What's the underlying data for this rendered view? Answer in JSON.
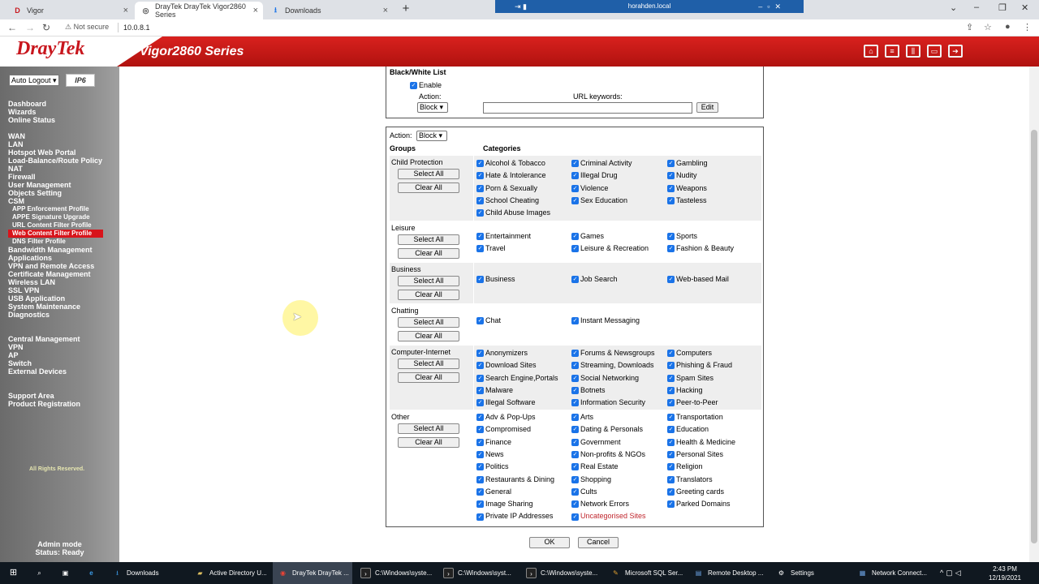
{
  "browser": {
    "tabs": [
      {
        "title": "Vigor",
        "fav": "D"
      },
      {
        "title": "DrayTek DrayTek Vigor2860 Series",
        "fav": "◎"
      },
      {
        "title": "Downloads",
        "fav": "⭳"
      }
    ],
    "remote_title": "horahden.local",
    "security_label": "Not secure",
    "url": "10.0.8.1"
  },
  "header": {
    "brand": "DrayTek",
    "model": "Vigor2860 Series"
  },
  "sidebar": {
    "auto_logout": "Auto Logout",
    "ipv6": "IP6",
    "groups": [
      [
        "Dashboard",
        "Wizards",
        "Online Status"
      ],
      [
        "WAN",
        "LAN",
        "Hotspot Web Portal",
        "Load-Balance/Route Policy",
        "NAT",
        "Firewall",
        "User Management",
        "Objects Setting",
        "CSM"
      ],
      [
        "Bandwidth Management",
        "Applications",
        "VPN and Remote Access",
        "Certificate Management",
        "Wireless LAN",
        "SSL VPN",
        "USB Application",
        "System Maintenance",
        "Diagnostics"
      ],
      [
        "Central Management",
        "VPN",
        "AP",
        "Switch",
        "External Devices"
      ],
      [
        "Support Area",
        "Product Registration"
      ]
    ],
    "csm_sub": [
      "APP Enforcement Profile",
      "APPE Signature Upgrade",
      "URL Content Filter Profile",
      "Web Content Filter Profile",
      "DNS Filter Profile"
    ],
    "rights": "All Rights Reserved.",
    "admin_mode": "Admin mode",
    "status": "Status: Ready"
  },
  "bwl": {
    "title": "Black/White List",
    "enable": "Enable",
    "action_label": "Action:",
    "action_value": "Block",
    "keywords_label": "URL keywords:",
    "keywords_value": "",
    "edit": "Edit"
  },
  "categories": {
    "action_label": "Action:",
    "action_value": "Block",
    "groups_header": "Groups",
    "categories_header": "Categories",
    "select_all": "Select All",
    "clear_all": "Clear All",
    "groups": [
      {
        "name": "Child Protection",
        "items": [
          "Alcohol & Tobacco",
          "Criminal Activity",
          "Gambling",
          "Hate & Intolerance",
          "Illegal Drug",
          "Nudity",
          "Porn & Sexually",
          "Violence",
          "Weapons",
          "School Cheating",
          "Sex Education",
          "Tasteless",
          "Child Abuse Images"
        ]
      },
      {
        "name": "Leisure",
        "items": [
          "Entertainment",
          "Games",
          "Sports",
          "Travel",
          "Leisure & Recreation",
          "Fashion & Beauty"
        ]
      },
      {
        "name": "Business",
        "items": [
          "Business",
          "Job Search",
          "Web-based Mail"
        ]
      },
      {
        "name": "Chatting",
        "items": [
          "Chat",
          "Instant Messaging"
        ]
      },
      {
        "name": "Computer-Internet",
        "items": [
          "Anonymizers",
          "Forums & Newsgroups",
          "Computers",
          "Download Sites",
          "Streaming, Downloads",
          "Phishing & Fraud",
          "Search Engine,Portals",
          "Social Networking",
          "Spam Sites",
          "Malware",
          "Botnets",
          "Hacking",
          "Illegal Software",
          "Information Security",
          "Peer-to-Peer"
        ]
      },
      {
        "name": "Other",
        "items": [
          "Adv & Pop-Ups",
          "Arts",
          "Transportation",
          "Compromised",
          "Dating & Personals",
          "Education",
          "Finance",
          "Government",
          "Health & Medicine",
          "News",
          "Non-profits & NGOs",
          "Personal Sites",
          "Politics",
          "Real Estate",
          "Religion",
          "Restaurants & Dining",
          "Shopping",
          "Translators",
          "General",
          "Cults",
          "Greeting cards",
          "Image Sharing",
          "Network Errors",
          "Parked Domains",
          "Private IP Addresses",
          "Uncategorised Sites"
        ]
      }
    ],
    "ok": "OK",
    "cancel": "Cancel"
  },
  "taskbar": {
    "items": [
      "Downloads",
      "Active Directory U...",
      "DrayTek DrayTek ...",
      "C:\\Windows\\syste...",
      "C:\\Windows\\syst...",
      "C:\\Windows\\syste...",
      "Microsoft SQL Ser...",
      "Remote Desktop ...",
      "Settings",
      "Network Connect..."
    ],
    "time": "2:43 PM",
    "date": "12/19/2021"
  }
}
